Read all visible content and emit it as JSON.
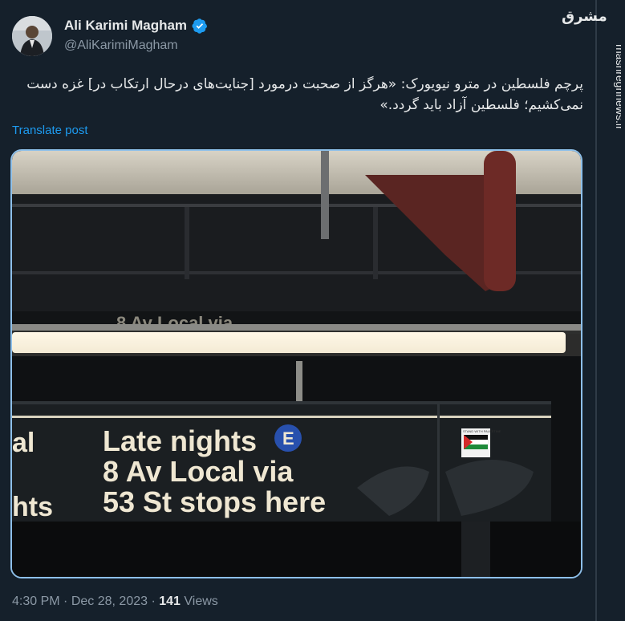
{
  "author": {
    "display_name": "Ali Karimi Magham",
    "handle": "@AliKarimiMagham",
    "verified": true
  },
  "post": {
    "text": "پرچم فلسطین در مترو نیویورک: «هرگز از صحبت درمورد [جنایت‌های درحال ارتکاب در] غزه دست نمی‌کشیم؛ فلسطین آزاد باید گردد.»",
    "translate_label": "Translate post",
    "time": "4:30 PM",
    "date": "Dec 28, 2023",
    "separator": "·",
    "views_count": "141",
    "views_label": "Views"
  },
  "media": {
    "sign_lines": [
      "Late nights",
      "8 Av Local via",
      "53 St stops here"
    ],
    "sign_left_fragments": [
      "al",
      "hts"
    ],
    "route_badge": "E",
    "top_sign_fragment": "8 Av Local via",
    "sticker_text": "STAND WITH PALESTINE"
  },
  "watermark": {
    "logo": "مشرق",
    "site": "mashreghnews.ir"
  },
  "colors": {
    "background": "#15202b",
    "link": "#1d9bf0",
    "verified": "#1d9bf0",
    "route_badge": "#2850ad"
  },
  "icons": {
    "verified": "verified-badge-icon",
    "more": "more-options-icon"
  }
}
